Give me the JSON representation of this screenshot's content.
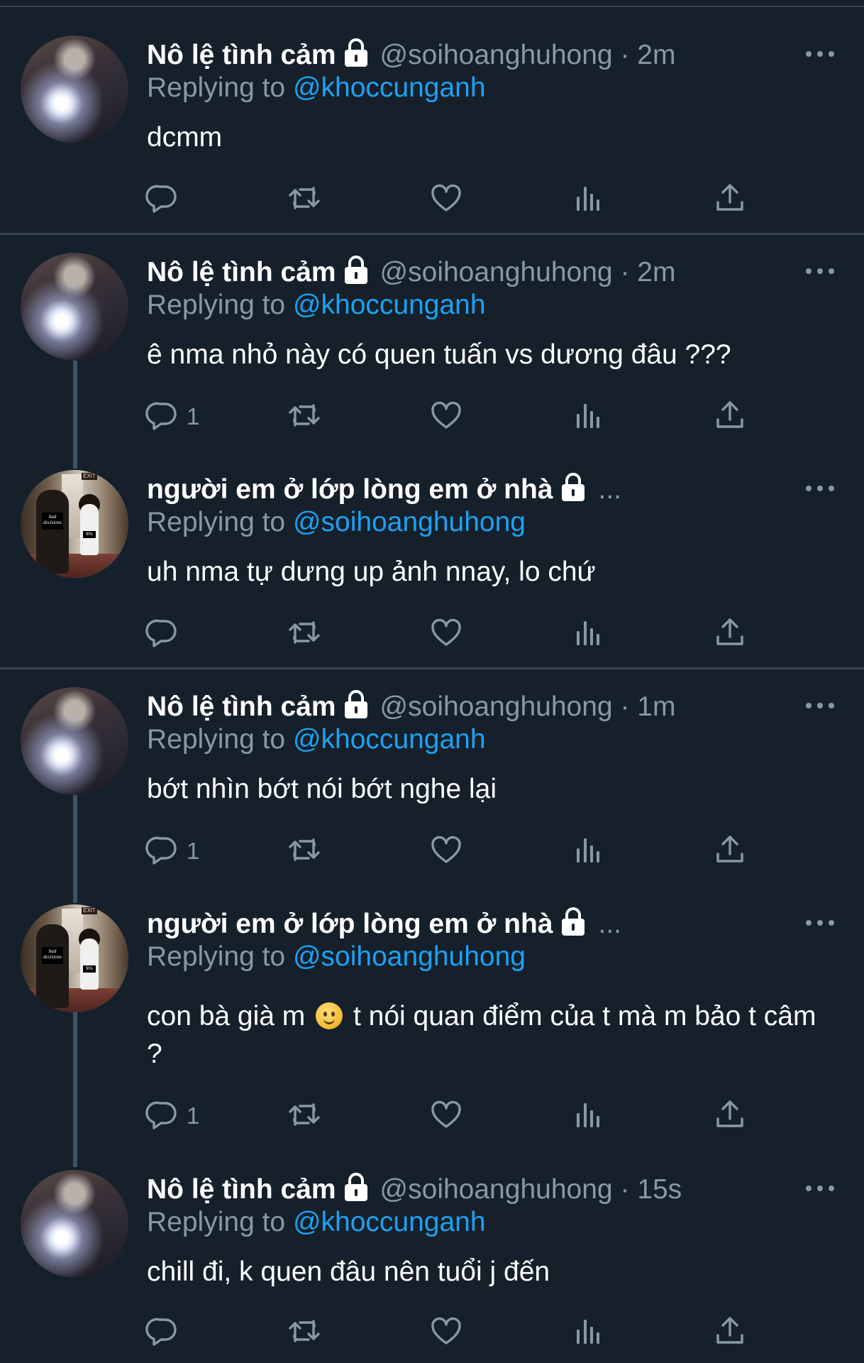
{
  "tweets": [
    {
      "name": "Nô lệ tình cảm",
      "handle": "@soihoanghuhong",
      "time": "· 2m",
      "replying_label": "Replying to ",
      "replying_to": "@khoccunganh",
      "text": "dcmm",
      "reply_count": ""
    },
    {
      "name": "Nô lệ tình cảm",
      "handle": "@soihoanghuhong",
      "time": "· 2m",
      "replying_label": "Replying to ",
      "replying_to": "@khoccunganh",
      "text": "ê nma nhỏ này có quen tuấn vs dương đâu ???",
      "reply_count": "1"
    },
    {
      "name": "người em ở lớp lòng em ở nhà",
      "ellipsis": "...",
      "replying_label": "Replying to ",
      "replying_to": "@soihoanghuhong",
      "text": "uh nma tự dưng up ảnh nnay, lo chứ",
      "reply_count": "",
      "avatar_text": {
        "exit": "EXIT",
        "sign": "bad decisions",
        "tag": "90s"
      }
    },
    {
      "name": "Nô lệ tình cảm",
      "handle": "@soihoanghuhong",
      "time": "· 1m",
      "replying_label": "Replying to ",
      "replying_to": "@khoccunganh",
      "text": "bớt nhìn bớt nói bớt nghe lại",
      "reply_count": "1"
    },
    {
      "name": "người em ở lớp lòng em ở nhà",
      "ellipsis": "...",
      "replying_label": "Replying to ",
      "replying_to": "@soihoanghuhong",
      "text_before": "con bà già m",
      "text_after": " t nói quan điểm của t mà m bảo t câm ?",
      "reply_count": "1",
      "avatar_text": {
        "exit": "EXIT",
        "sign": "bad decisions",
        "tag": "90s"
      }
    },
    {
      "name": "Nô lệ tình cảm",
      "handle": "@soihoanghuhong",
      "time": "· 15s",
      "replying_label": "Replying to ",
      "replying_to": "@khoccunganh",
      "text": "chill đi, k quen đâu nên tuổi j đến",
      "reply_count": ""
    }
  ],
  "colors": {
    "background": "#15202b",
    "secondary_text": "#8899a6",
    "mention": "#1da1f2",
    "divider": "#38444d",
    "thread_line": "#3d5466"
  },
  "icons": [
    "lock-icon",
    "more-icon",
    "reply-icon",
    "retweet-icon",
    "like-icon",
    "analytics-icon",
    "share-icon"
  ]
}
